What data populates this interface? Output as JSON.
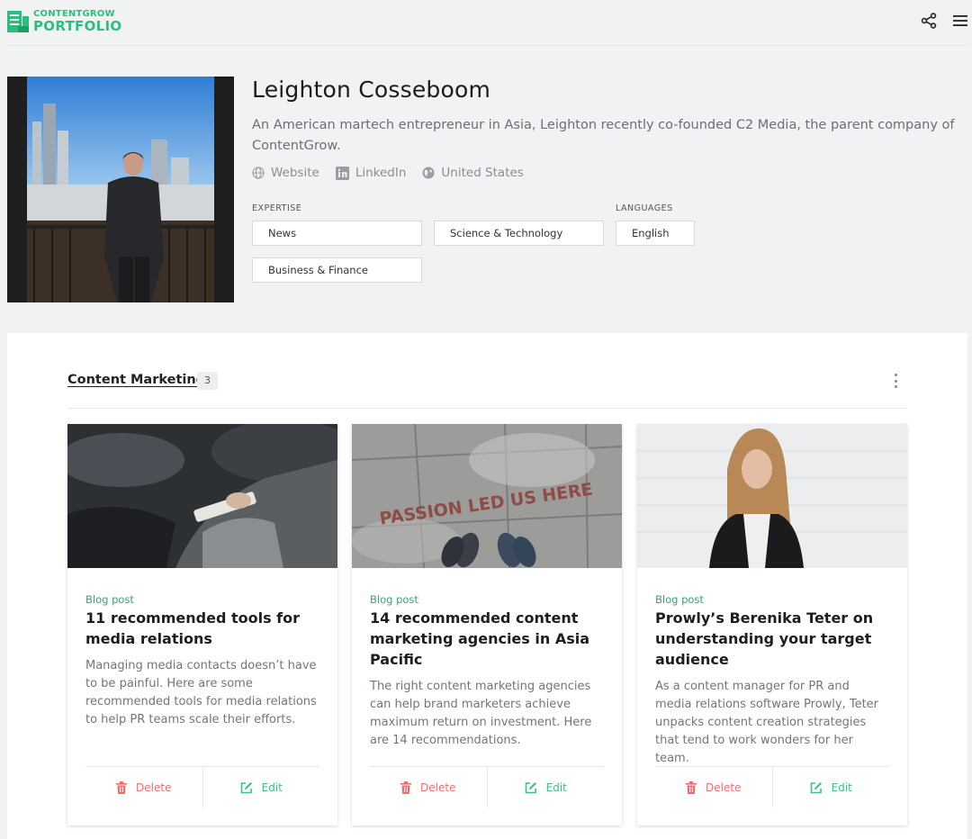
{
  "brand": {
    "line1": "CONTENTGROW",
    "line2": "PORTFOLIO",
    "accent": "#2bbf7d",
    "icon": "logo-mark-icon"
  },
  "header_icons": [
    "share-icon",
    "hamburger-menu-icon"
  ],
  "profile": {
    "name": "Leighton Cosseboom",
    "bio": "An American martech entrepreneur in Asia, Leighton recently co-founded C2 Media, the parent company of ContentGrow.",
    "links": {
      "website": "Website",
      "linkedin": "LinkedIn",
      "location": "United States"
    },
    "expertise_label": "EXPERTISE",
    "expertise": [
      "News",
      "Science & Technology",
      "Business & Finance"
    ],
    "languages_label": "LANGUAGES",
    "languages": [
      "English"
    ]
  },
  "section": {
    "title": "Content Marketing",
    "count": "3"
  },
  "cards": [
    {
      "type": "Blog post",
      "title": "11 recommended tools for media relations",
      "description": "Managing media contacts doesn’t have to be painful. Here are some recommended tools for media relations to help PR teams scale their efforts.",
      "delete_label": "Delete",
      "edit_label": "Edit"
    },
    {
      "type": "Blog post",
      "title": "14 recommended content marketing agencies in Asia Pacific",
      "description": "The right content marketing agencies can help brand marketers achieve maximum return on investment. Here are 14 recommendations.",
      "image_text": "PASSION LED US HERE",
      "delete_label": "Delete",
      "edit_label": "Edit"
    },
    {
      "type": "Blog post",
      "title": "Prowly’s Berenika Teter on understanding your target audience",
      "description": "As a content manager for PR and media relations software Prowly, Teter unpacks content creation strategies that tend to work wonders for her team.",
      "delete_label": "Delete",
      "edit_label": "Edit"
    }
  ],
  "colors": {
    "delete": "#f26a6a",
    "edit": "#3cbf88",
    "type": "#3aa173"
  }
}
